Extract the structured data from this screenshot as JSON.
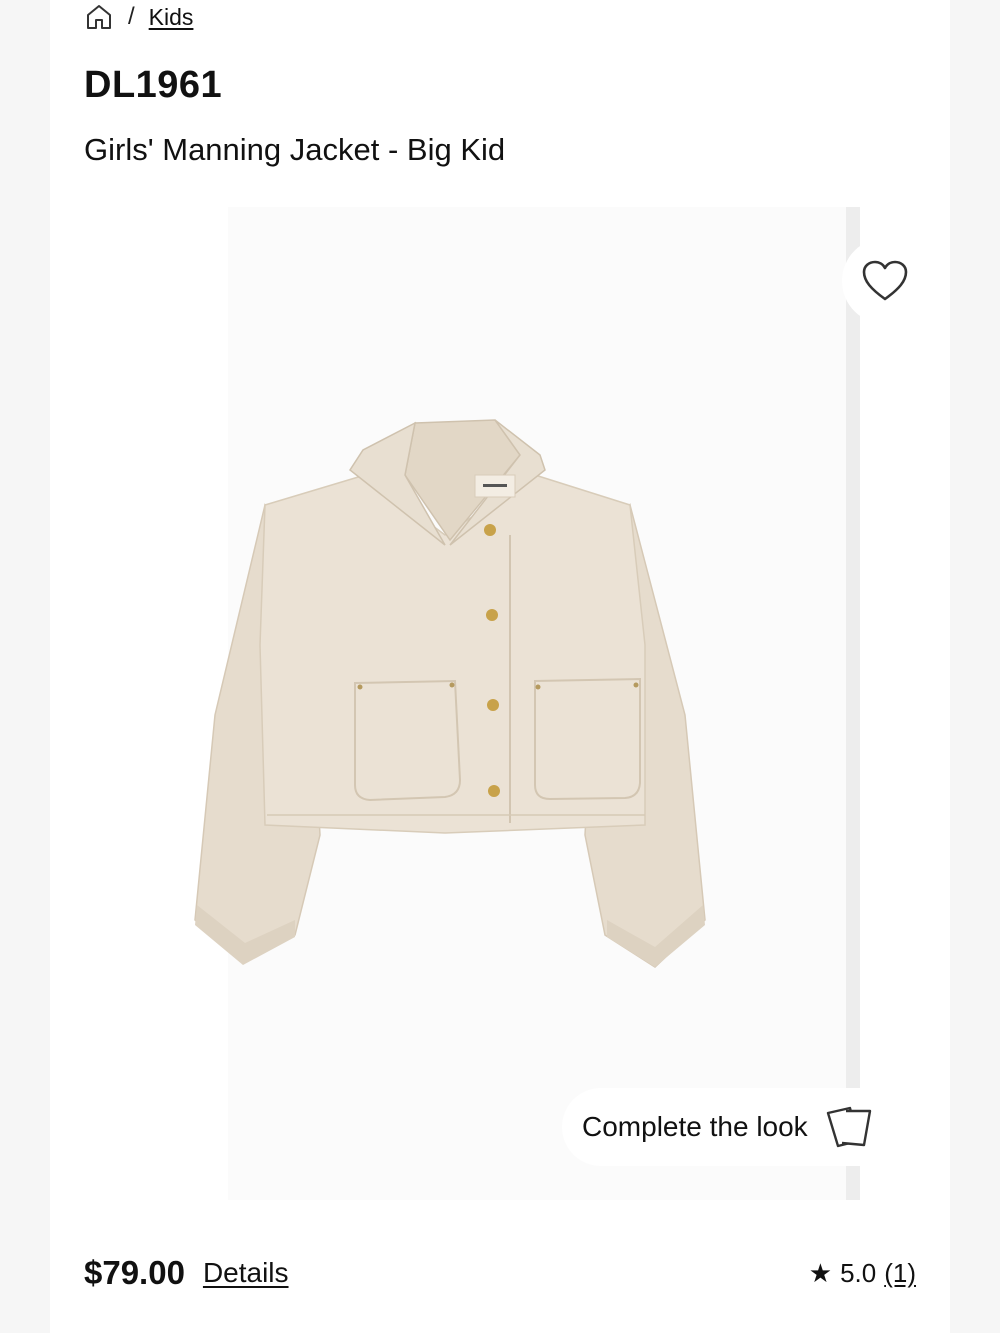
{
  "breadcrumb": {
    "home_icon": "home-icon",
    "separator": "/",
    "current": "Kids"
  },
  "product": {
    "brand": "DL1961",
    "name": "Girls' Manning Jacket - Big Kid",
    "price": "$79.00",
    "details_label": "Details",
    "label_text": "DL1961"
  },
  "gallery": {
    "favorite_icon": "heart-outline-icon",
    "complete_look_label": "Complete the look",
    "complete_look_icon": "cards-icon"
  },
  "rating": {
    "score": "5.0",
    "count": "(1)",
    "icon": "star-icon"
  },
  "colors": {
    "jacket": "#e9dfd1",
    "jacket_shadow": "#d9cdbb",
    "button_gold": "#c8a24a",
    "page_bg": "#ffffff",
    "outer_bg": "#f6f6f6"
  }
}
